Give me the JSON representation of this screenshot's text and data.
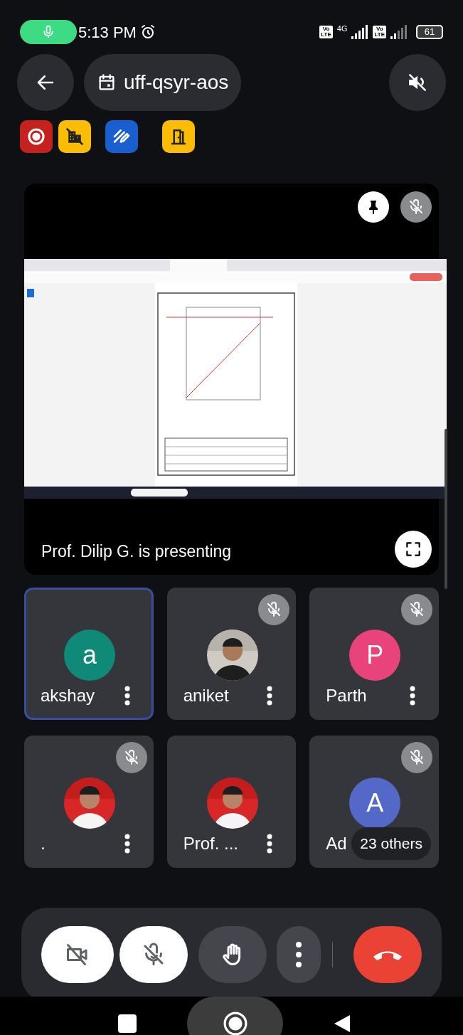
{
  "status_bar": {
    "time": "5:13 PM",
    "recording_mic": true,
    "sims": [
      {
        "badge_top": "Vo",
        "badge_bottom": "LTE",
        "network": "4G"
      },
      {
        "badge_top": "Vo",
        "badge_bottom": "LTE"
      }
    ],
    "battery": "61"
  },
  "header": {
    "meeting_code": "uff-qsyr-aos",
    "speaker_muted": true
  },
  "meeting_tools": [
    {
      "kind": "record",
      "color": "#c5221f"
    },
    {
      "kind": "no-layout",
      "color": "#fbbc04"
    },
    {
      "kind": "whiteboard",
      "color": "#1a5fd0"
    },
    {
      "kind": "door",
      "color": "#fbbc04"
    }
  ],
  "presentation": {
    "kind": "picture",
    "pinned": true,
    "muted": true,
    "caption": "Prof. Dilip G. is presenting"
  },
  "participants": [
    {
      "name": "akshay",
      "selected": true,
      "muted": false,
      "avatar": {
        "kind": "letter",
        "letter": "a",
        "color": "#0f8a78"
      }
    },
    {
      "name": "aniket",
      "selected": false,
      "muted": true
    },
    {
      "name": "Parth",
      "selected": false,
      "muted": true,
      "avatar": {
        "kind": "letter",
        "letter": "P",
        "color": "#e8437a"
      }
    },
    {
      "name": ".",
      "selected": false,
      "muted": true
    },
    {
      "name": "Prof. ...",
      "selected": false,
      "muted": false
    },
    {
      "name": "Ad",
      "selected": false,
      "muted": true,
      "avatar": {
        "kind": "letter",
        "letter": "A",
        "color": "#5468c8"
      },
      "overlay": "23 others"
    }
  ],
  "controls": [
    {
      "kind": "camera",
      "on": false
    },
    {
      "kind": "mic",
      "on": false
    },
    {
      "kind": "hand"
    },
    {
      "kind": "more"
    },
    {
      "kind": "leave"
    }
  ]
}
